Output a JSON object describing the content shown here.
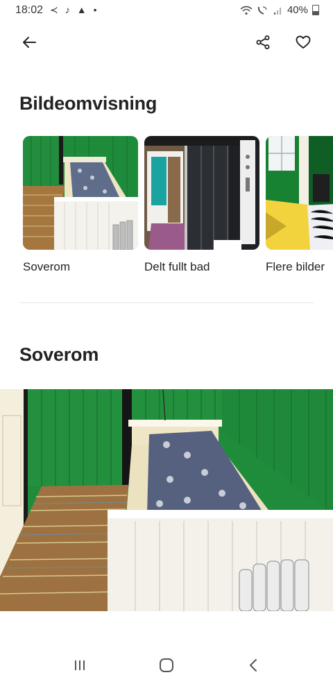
{
  "status_bar": {
    "time": "18:02",
    "left_icons": [
      "vlc-arrow-icon",
      "music-note-icon",
      "bell-icon",
      "dot-icon"
    ],
    "right_icons": [
      "wifi-icon",
      "wifi-call-icon",
      "signal-icon"
    ],
    "battery": "40%"
  },
  "header": {
    "back_icon": "arrow-left-icon",
    "share_icon": "share-icon",
    "favorite_icon": "heart-outline-icon"
  },
  "gallery": {
    "title": "Bildeomvisning",
    "items": [
      {
        "label": "Soverom"
      },
      {
        "label": "Delt fullt bad"
      },
      {
        "label": "Flere bilder"
      }
    ]
  },
  "section": {
    "title": "Soverom"
  },
  "nav_bar": {
    "icons": [
      "recent-apps-icon",
      "home-icon",
      "back-icon"
    ]
  },
  "colors": {
    "wall_green": "#1f8a3a",
    "text": "#222222",
    "divider": "#e4e4e4"
  }
}
